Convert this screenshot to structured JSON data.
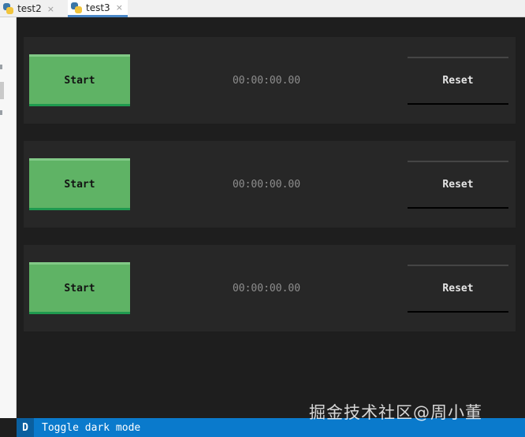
{
  "tabs": [
    {
      "label": "test2",
      "close": "×"
    },
    {
      "label": "test3",
      "close": "×"
    }
  ],
  "stopwatches": [
    {
      "start_label": "Start",
      "time": "00:00:00.00",
      "reset_label": "Reset"
    },
    {
      "start_label": "Start",
      "time": "00:00:00.00",
      "reset_label": "Reset"
    },
    {
      "start_label": "Start",
      "time": "00:00:00.00",
      "reset_label": "Reset"
    }
  ],
  "footer": {
    "key": "D",
    "label": "Toggle dark mode"
  },
  "watermark": "掘金技术社区@周小董",
  "colors": {
    "background": "#1e1e1e",
    "row": "#272727",
    "start_button": "#5fb365",
    "footer": "#0a7acc"
  }
}
